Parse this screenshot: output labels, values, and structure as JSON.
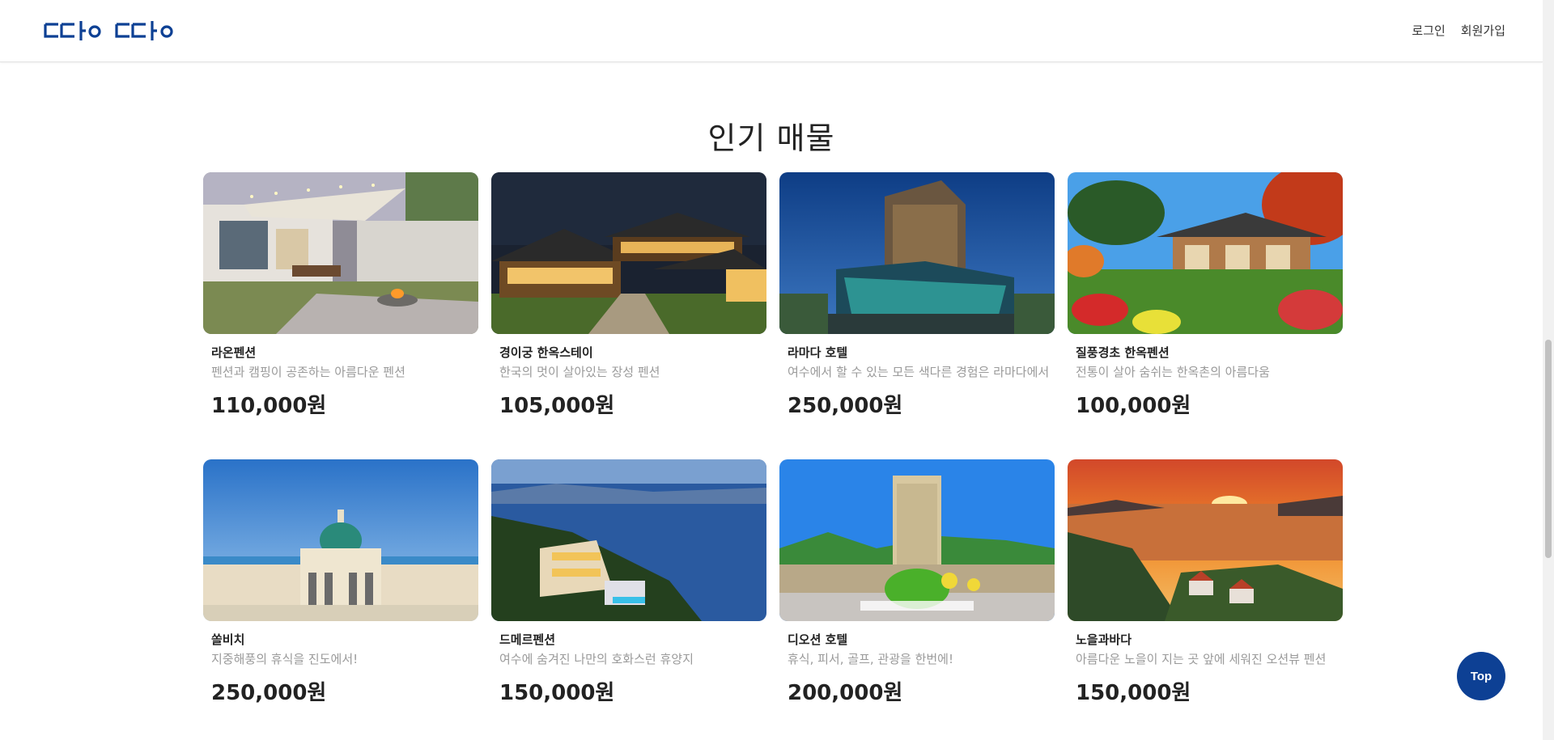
{
  "header": {
    "logo_text": "ㄷㅏㅇ ㄷㅏㅇ",
    "nav": {
      "login": "로그인",
      "signup": "회원가입"
    }
  },
  "section": {
    "title": "인기 매물"
  },
  "listings": [
    {
      "name": "라온펜션",
      "desc": "펜션과 캠핑이 공존하는 아름다운 펜션",
      "price": "110,000원"
    },
    {
      "name": "경이궁 한옥스테이",
      "desc": "한국의 멋이 살아있는 장성 펜션",
      "price": "105,000원"
    },
    {
      "name": "라마다 호텔",
      "desc": "여수에서 할 수 있는 모든 색다른 경험은 라마다에서",
      "price": "250,000원"
    },
    {
      "name": "질풍경초 한옥펜션",
      "desc": "전통이 살아 숨쉬는 한옥촌의 아름다움",
      "price": "100,000원"
    },
    {
      "name": "쏠비치",
      "desc": "지중해풍의 휴식을 진도에서!",
      "price": "250,000원"
    },
    {
      "name": "드메르펜션",
      "desc": "여수에 숨겨진 나만의 호화스런 휴양지",
      "price": "150,000원"
    },
    {
      "name": "디오션 호텔",
      "desc": "휴식, 피서, 골프, 관광을 한번에!",
      "price": "200,000원"
    },
    {
      "name": "노을과바다",
      "desc": "아름다운 노을이 지는 곳 앞에 세워진 오션뷰 펜션",
      "price": "150,000원"
    }
  ],
  "top_button": {
    "label": "Top"
  },
  "colors": {
    "brand": "#0d4094",
    "muted_text": "#9a9a9a"
  }
}
